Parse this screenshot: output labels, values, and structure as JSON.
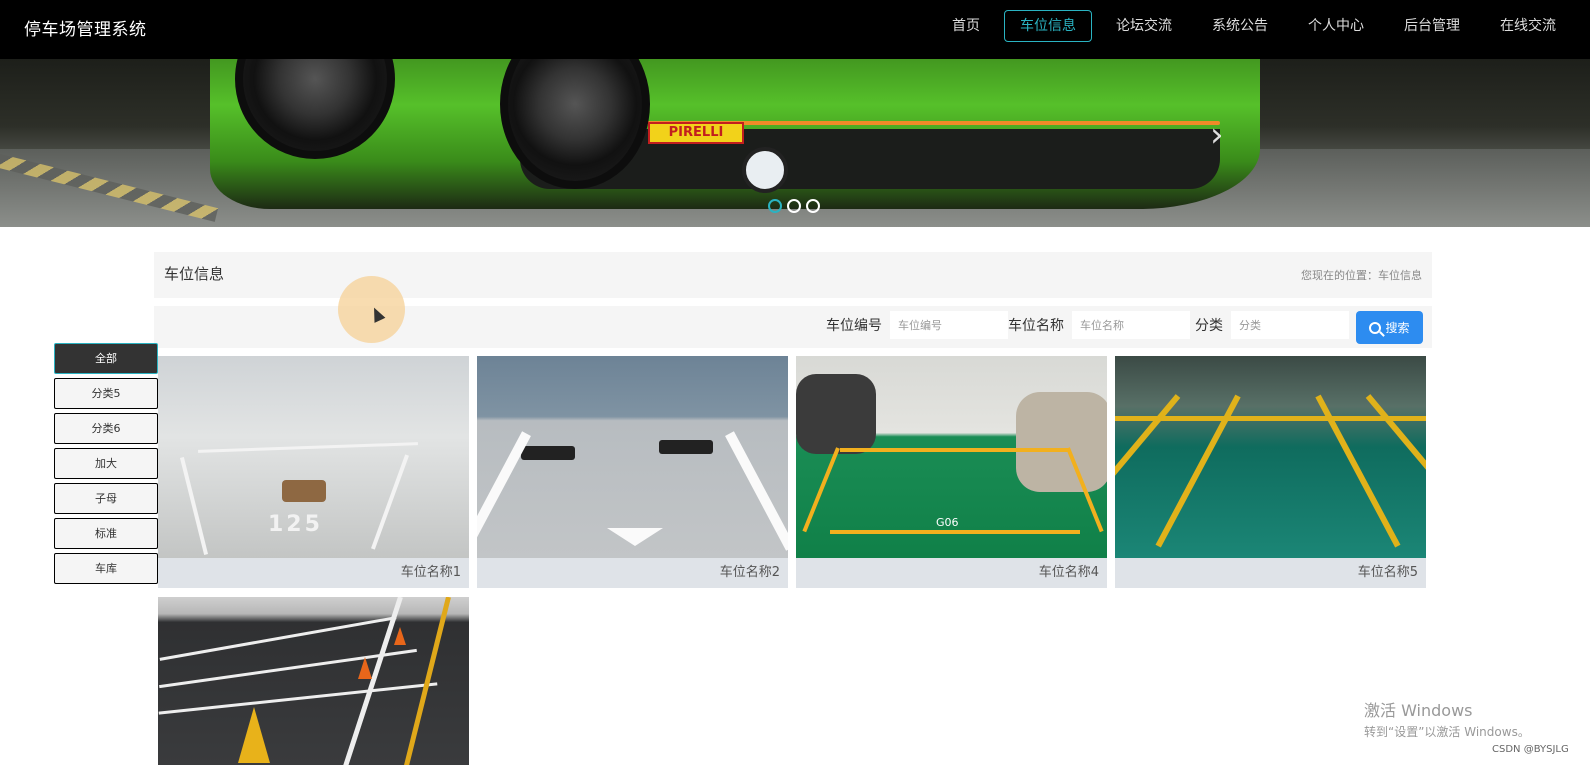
{
  "brand": "停车场管理系统",
  "nav": [
    {
      "label": "首页",
      "active": false
    },
    {
      "label": "车位信息",
      "active": true
    },
    {
      "label": "论坛交流",
      "active": false
    },
    {
      "label": "系统公告",
      "active": false
    },
    {
      "label": "个人中心",
      "active": false
    },
    {
      "label": "后台管理",
      "active": false
    },
    {
      "label": "在线交流",
      "active": false
    }
  ],
  "banner": {
    "logo_text": "PIRELLI",
    "active_slide": 1,
    "slide_count": 3
  },
  "breadcrumb": {
    "title": "车位信息",
    "position": "您现在的位置：车位信息"
  },
  "search": {
    "code_label": "车位编号",
    "code_placeholder": "车位编号",
    "name_label": "车位名称",
    "name_placeholder": "车位名称",
    "category_label": "分类",
    "category_placeholder": "分类",
    "button": "搜索"
  },
  "categories": [
    {
      "label": "全部",
      "active": true
    },
    {
      "label": "分类5",
      "active": false
    },
    {
      "label": "分类6",
      "active": false
    },
    {
      "label": "加大",
      "active": false
    },
    {
      "label": "子母",
      "active": false
    },
    {
      "label": "标准",
      "active": false
    },
    {
      "label": "车库",
      "active": false
    }
  ],
  "cards": [
    {
      "name": "车位名称1",
      "image": "indoor-parking-125"
    },
    {
      "name": "车位名称2",
      "image": "outdoor-parking-white"
    },
    {
      "name": "车位名称4",
      "image": "green-parking-G06"
    },
    {
      "name": "车位名称5",
      "image": "green-parking-yellow-lines"
    },
    {
      "name": "",
      "image": "outdoor-parking-cones"
    }
  ],
  "image_texts": {
    "spot_125": "125",
    "spot_g06": "G06"
  },
  "watermark": {
    "title": "激活 Windows",
    "subtitle": "转到“设置”以激活 Windows。"
  },
  "credit": "CSDN @BYSJLG",
  "colors": {
    "accent": "#2ab3c2",
    "search_button": "#2d8cf0",
    "topbar": "#000000"
  }
}
